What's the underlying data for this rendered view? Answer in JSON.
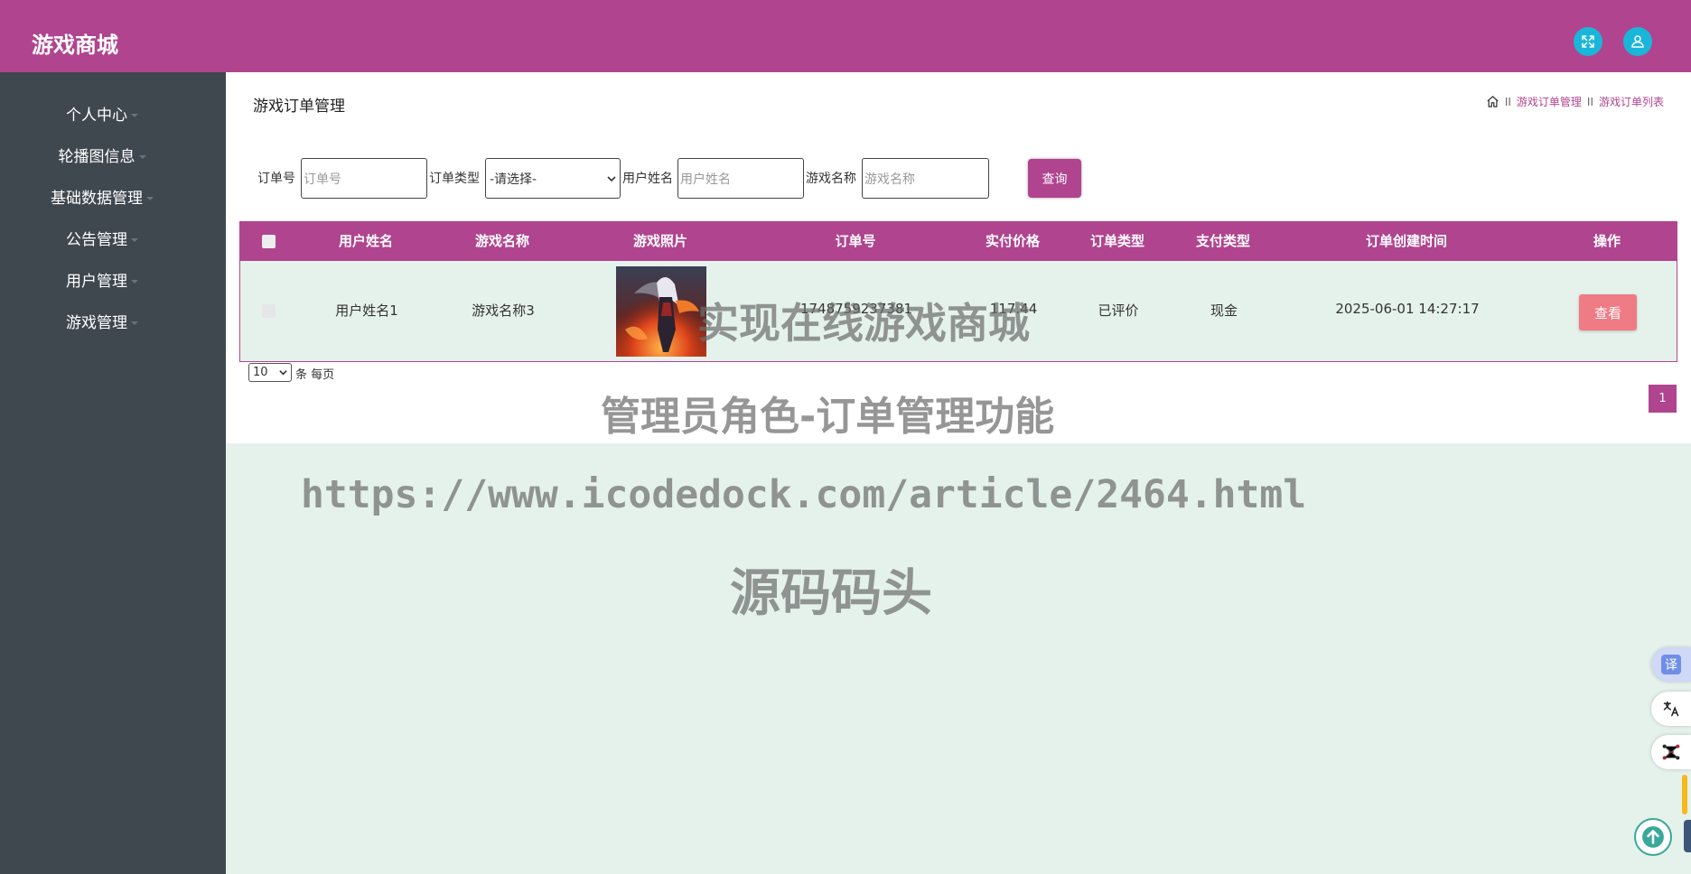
{
  "header": {
    "brand": "游戏商城"
  },
  "icons": {
    "fullscreen": "fullscreen-icon",
    "user": "user-icon",
    "home": "home-icon"
  },
  "sidebar": {
    "items": [
      {
        "label": "个人中心"
      },
      {
        "label": "轮播图信息"
      },
      {
        "label": "基础数据管理"
      },
      {
        "label": "公告管理"
      },
      {
        "label": "用户管理"
      },
      {
        "label": "游戏管理"
      }
    ]
  },
  "page": {
    "title": "游戏订单管理",
    "breadcrumb": {
      "sep": "II",
      "crumb1": "游戏订单管理",
      "crumb2": "游戏订单列表"
    }
  },
  "filters": {
    "order_no_label": "订单号",
    "order_no_placeholder": "订单号",
    "order_type_label": "订单类型",
    "order_type_selected": "-请选择-",
    "user_name_label": "用户姓名",
    "user_name_placeholder": "用户姓名",
    "game_name_label": "游戏名称",
    "game_name_placeholder": "游戏名称",
    "query_button": "查询"
  },
  "table": {
    "columns": [
      "用户姓名",
      "游戏名称",
      "游戏照片",
      "订单号",
      "实付价格",
      "订单类型",
      "支付类型",
      "订单创建时间",
      "操作"
    ],
    "rows": [
      {
        "user_name": "用户姓名1",
        "game_name": "游戏名称3",
        "order_no": "1748759237381",
        "price": "117.44",
        "order_type": "已评价",
        "pay_type": "现金",
        "created": "2025-06-01 14:27:17",
        "action": "查看"
      }
    ]
  },
  "pagination": {
    "page_size": "10",
    "per_page_text": "条 每页",
    "current_page": "1"
  },
  "watermark": {
    "line1": "实现在线游戏商城",
    "line2": "管理员角色-订单管理功能",
    "line3": "https://www.icodedock.com/article/2464.html",
    "line4": "源码码头"
  },
  "floating": {
    "translate_label": "译"
  },
  "colors": {
    "primary": "#b0448f",
    "sidebar": "#3f474f",
    "accent_icon": "#1ab6d9",
    "view_button": "#ef7b84",
    "background": "#e5f2ec"
  }
}
